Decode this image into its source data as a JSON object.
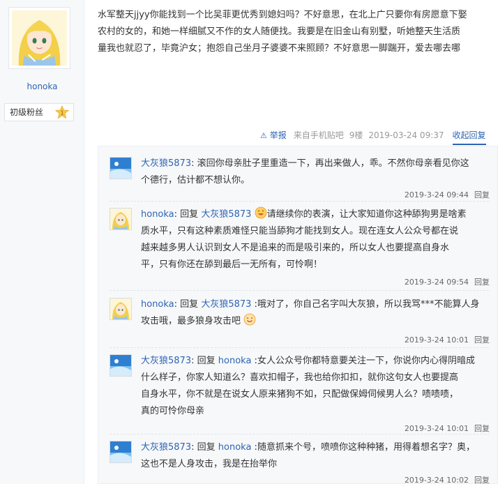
{
  "author": {
    "name": "honoka",
    "level_title": "初级粉丝",
    "level_number": "1",
    "avatar": "anime-girl-avatar"
  },
  "post": {
    "lines": [
      "水军整天jjyy你能找到一个比吴菲更优秀到媳妇吗？不好意思，在北上广只要你有房愿意下娶",
      "农村的女的，和她一样细腻又不作的女人随便找。我要是在旧金山有别墅，听她整天生活质",
      "量我也就忍了，毕竟沪女；抱怨自己坐月子婆婆不来照顾？不好意思一脚踹开，爱去哪去哪"
    ],
    "meta": {
      "report": "举报",
      "source": "来自手机贴吧",
      "floor": "9楼",
      "time": "2019-03-24 09:37",
      "collapse": "收起回复"
    }
  },
  "replies": [
    {
      "user": "大灰狼5873",
      "avatar": "sky-avatar",
      "reply_word": "",
      "target": "",
      "lines": [
        "滚回你母亲肚子里重造一下，再出来做人，乖。不然你母亲看见你这",
        "个德行，估计都不想认你。"
      ],
      "time": "2019-3-24 09:44",
      "reply_label": "回复"
    },
    {
      "user": "honoka",
      "avatar": "anime-girl-avatar",
      "reply_word": "回复",
      "target": "大灰狼5873",
      "lines": [
        "请继续你的表演，让大家知道你这种舔狗男是啥素",
        "质水平，只有这种素质难怪只能当舔狗才能找到女人。现在连女人公众号都在说",
        "越来越多男人认识到女人不是追来的而是吸引来的，所以女人也要提高自身水",
        "平，只有你还在舔到最后一无所有，可怜啊！"
      ],
      "time": "2019-3-24 09:54",
      "reply_label": "回复"
    },
    {
      "user": "honoka",
      "avatar": "anime-girl-avatar",
      "reply_word": "回复",
      "target": "大灰狼5873",
      "lines": [
        "哦对了，你自己名字叫大灰狼，所以我骂***不能算人身",
        "攻击哦，最多狼身攻击吧"
      ],
      "time": "2019-3-24 10:01",
      "reply_label": "回复"
    },
    {
      "user": "大灰狼5873",
      "avatar": "sky-avatar",
      "reply_word": "回复",
      "target": "honoka",
      "lines": [
        "女人公众号你都特意要关注一下，你说你内心得阴暗成",
        "什么样子，你家人知道么？喜欢扣帽子，我也给你扣扣，就你这句女人也要提高",
        "自身水平，你不就是在说女人原来猪狗不如，只配做保姆伺候男人么？啧啧啧，",
        "真的可怜你母亲"
      ],
      "time": "2019-3-24 10:01",
      "reply_label": "回复"
    },
    {
      "user": "大灰狼5873",
      "avatar": "sky-avatar",
      "reply_word": "回复",
      "target": "honoka",
      "lines": [
        "随意抓来个号，喷喷你这种种猪，用得着想名字？奥，",
        "这也不是人身攻击，我是在抬举你"
      ],
      "time": "2019-3-24 10:02",
      "reply_label": "回复"
    }
  ],
  "colors": {
    "link": "#2d64b3",
    "meta": "#999999",
    "panel": "#f7f8fa"
  }
}
